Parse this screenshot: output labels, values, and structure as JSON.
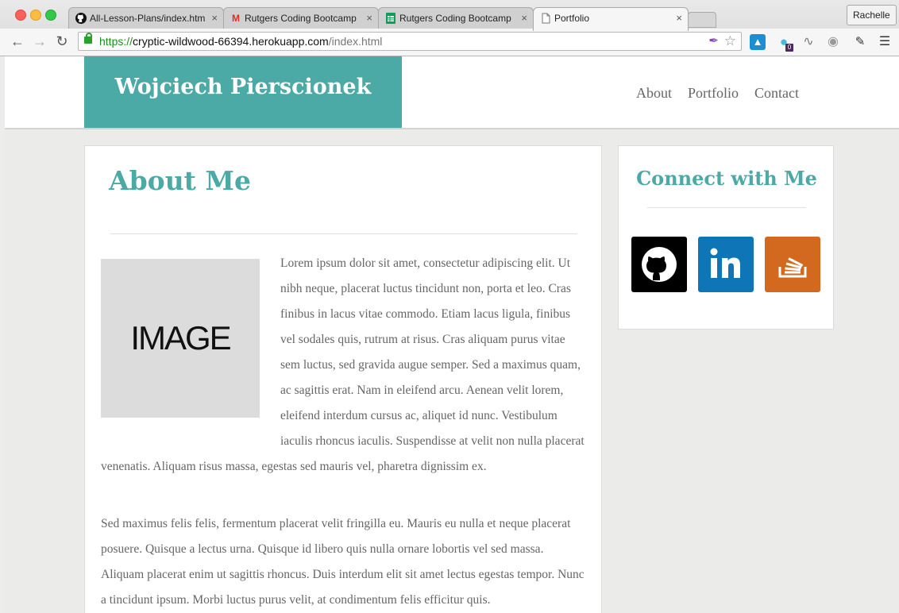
{
  "browser": {
    "tabs": [
      {
        "title": "All-Lesson-Plans/index.htm",
        "icon": "github-icon"
      },
      {
        "title": "Rutgers Coding Bootcamp",
        "icon": "gmail-icon"
      },
      {
        "title": "Rutgers Coding Bootcamp",
        "icon": "sheets-icon"
      },
      {
        "title": "Portfolio",
        "icon": "document-icon"
      }
    ],
    "user_button": "Rachelle",
    "url_scheme": "https://",
    "url_host": "cryptic-wildwood-66394.herokuapp.com",
    "url_path": "/index.html",
    "extension_badge": "0"
  },
  "site": {
    "brand": "Wojciech Pierscionek",
    "nav": [
      "About",
      "Portfolio",
      "Contact"
    ]
  },
  "about": {
    "title": "About Me",
    "image_placeholder": "IMAGE",
    "paragraph1": "Lorem ipsum dolor sit amet, consectetur adipiscing elit. Ut nibh neque, placerat luctus tincidunt non, porta et leo. Cras finibus in lacus vitae commodo. Etiam lacus ligula, finibus vel sodales quis, rutrum at risus. Cras aliquam purus vitae sem luctus, sed gravida augue semper. Sed a maximus quam, ac sagittis erat. Nam in eleifend arcu. Aenean velit lorem, eleifend interdum cursus ac, aliquet id nunc. Vestibulum iaculis rhoncus iaculis. Suspendisse at velit non nulla placerat venenatis. Aliquam risus massa, egestas sed mauris vel, pharetra dignissim ex.",
    "paragraph2": "Sed maximus felis felis, fermentum placerat velit fringilla eu. Mauris eu nulla et neque placerat posuere. Quisque a lectus urna. Quisque id libero quis nulla ornare lobortis vel sed massa. Aliquam placerat enim ut sagittis rhoncus. Duis interdum elit sit amet lectus egestas tempor. Nunc a tincidunt ipsum. Morbi luctus purus velit, at condimentum felis efficitur quis."
  },
  "connect": {
    "title": "Connect with Me",
    "links": [
      {
        "icon": "github-icon",
        "color": "#000000"
      },
      {
        "icon": "linkedin-icon",
        "color": "#0e76b6"
      },
      {
        "icon": "stackoverflow-icon",
        "color": "#d2691e"
      }
    ]
  },
  "colors": {
    "accent": "#4ba9a6"
  }
}
